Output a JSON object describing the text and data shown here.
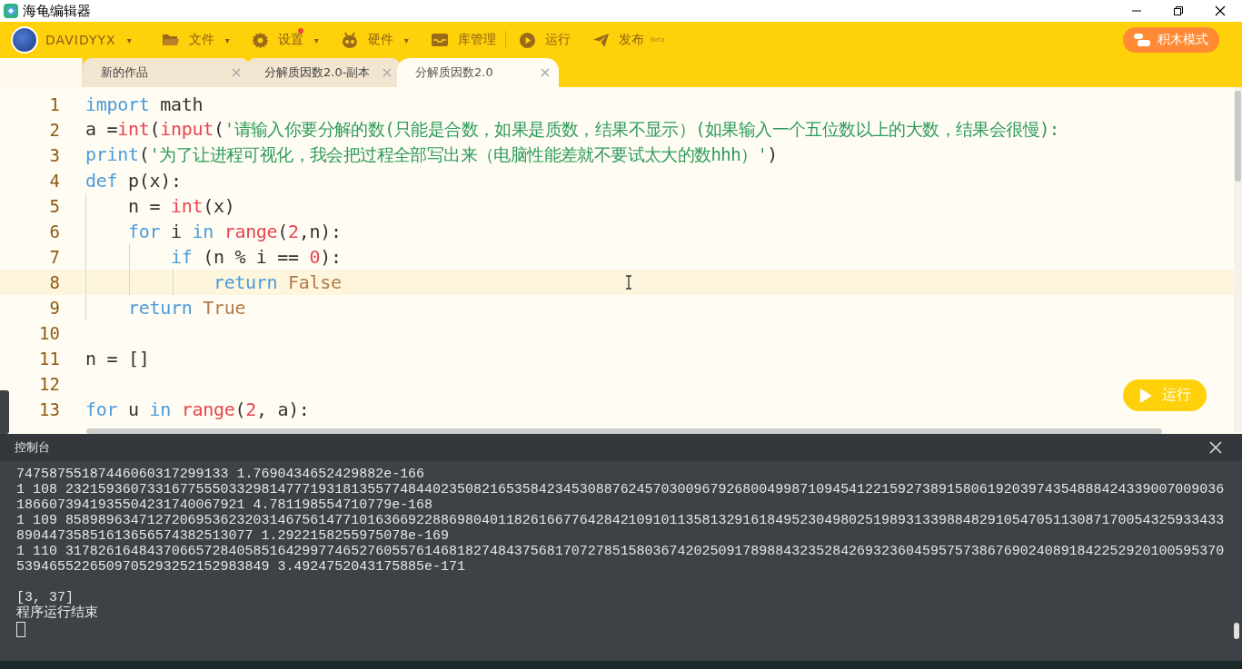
{
  "window": {
    "title": "海龟编辑器"
  },
  "toolbar": {
    "user": "DAVIDYYX",
    "user_caret": "▾",
    "menus": [
      {
        "label": "文件",
        "kind": "dropdown",
        "caret": "▾",
        "notify": false
      },
      {
        "label": "设置",
        "kind": "dropdown",
        "caret": "▾",
        "notify": true
      },
      {
        "label": "硬件",
        "kind": "dropdown",
        "caret": "▾",
        "notify": false
      },
      {
        "label": "库管理",
        "kind": "plain",
        "notify": false
      },
      {
        "label": "运行",
        "kind": "plain",
        "notify": false
      },
      {
        "label": "发布",
        "kind": "beta",
        "badge": "Beta",
        "notify": false
      }
    ],
    "mode_button": "积木模式"
  },
  "tabs": [
    {
      "label": "新的作品",
      "selected": false
    },
    {
      "label": "分解质因数2.0-副本",
      "selected": false
    },
    {
      "label": "分解质因数2.0",
      "selected": true
    }
  ],
  "editor": {
    "lines": [
      {
        "n": "1",
        "current": false,
        "tokens": [
          {
            "text": "import",
            "kind": "keyword"
          },
          {
            "text": " math",
            "kind": "plain"
          }
        ]
      },
      {
        "n": "2",
        "current": false,
        "tokens": [
          {
            "text": "a =",
            "kind": "plain"
          },
          {
            "text": "int",
            "kind": "builtin"
          },
          {
            "text": "(",
            "kind": "plain"
          },
          {
            "text": "input",
            "kind": "builtin"
          },
          {
            "text": "(",
            "kind": "plain"
          },
          {
            "text": "'请输入你要分解的数(只能是合数，如果是质数，结果不显示）(如果输入一个五位数以上的大数，结果会很慢):",
            "kind": "string"
          }
        ]
      },
      {
        "n": "3",
        "current": false,
        "tokens": [
          {
            "text": "print",
            "kind": "keyword"
          },
          {
            "text": "(",
            "kind": "plain"
          },
          {
            "text": "'为了让进程可视化，我会把过程全部写出来（电脑性能差就不要试太大的数hhh）'",
            "kind": "string"
          },
          {
            "text": ")",
            "kind": "plain"
          }
        ]
      },
      {
        "n": "4",
        "current": false,
        "tokens": [
          {
            "text": "def",
            "kind": "keyword"
          },
          {
            "text": " p(x):",
            "kind": "plain"
          }
        ]
      },
      {
        "n": "5",
        "current": false,
        "tokens": [
          {
            "text": "    n = ",
            "kind": "plain"
          },
          {
            "text": "int",
            "kind": "builtin"
          },
          {
            "text": "(x)",
            "kind": "plain"
          }
        ]
      },
      {
        "n": "6",
        "current": false,
        "tokens": [
          {
            "text": "    for",
            "kind": "keyword"
          },
          {
            "text": " i ",
            "kind": "plain"
          },
          {
            "text": "in",
            "kind": "keyword"
          },
          {
            "text": " range",
            "kind": "builtin"
          },
          {
            "text": "(",
            "kind": "plain"
          },
          {
            "text": "2",
            "kind": "number"
          },
          {
            "text": ",n):",
            "kind": "plain"
          }
        ]
      },
      {
        "n": "7",
        "current": false,
        "tokens": [
          {
            "text": "        if",
            "kind": "keyword"
          },
          {
            "text": " (n % i == ",
            "kind": "plain"
          },
          {
            "text": "0",
            "kind": "number"
          },
          {
            "text": "):",
            "kind": "plain"
          }
        ]
      },
      {
        "n": "8",
        "current": true,
        "tokens": [
          {
            "text": "            return",
            "kind": "keyword"
          },
          {
            "text": " False",
            "kind": "constant"
          }
        ]
      },
      {
        "n": "9",
        "current": false,
        "tokens": [
          {
            "text": "    return",
            "kind": "keyword"
          },
          {
            "text": " True",
            "kind": "constant"
          }
        ]
      },
      {
        "n": "10",
        "current": false
      },
      {
        "n": "11",
        "current": false,
        "tokens": [
          {
            "text": "n = []",
            "kind": "plain"
          }
        ]
      },
      {
        "n": "12",
        "current": false
      },
      {
        "n": "13",
        "current": false,
        "tokens": [
          {
            "text": "for",
            "kind": "keyword"
          },
          {
            "text": " u ",
            "kind": "plain"
          },
          {
            "text": "in",
            "kind": "keyword"
          },
          {
            "text": " range",
            "kind": "builtin"
          },
          {
            "text": "(",
            "kind": "plain"
          },
          {
            "text": "2",
            "kind": "number"
          },
          {
            "text": ", a):",
            "kind": "plain"
          }
        ]
      }
    ]
  },
  "run_button": "运行",
  "console": {
    "title": "控制台",
    "blocks": [
      [
        "74758755187446060317299133 1.7690434652429882e-166",
        "1 108 2321593607331677555033298147771931813557748440235082165358423453088762457030096792680049987109454122159273891580619203974354888424339007009036",
        "1866073941935504231740067921 4.781198554710779e-168",
        "1 109 8589896347127206953623203146756147710163669228869804011826166776428421091011358132916184952304980251989313398848291054705113087170054325933433",
        "89044735851613656574382513077 1.2922158255975078e-169",
        "1 110 3178261648437066572840585164299774652760557614681827484375681707278515803674202509178988432352842693236045957573867690240891842252920100595370",
        "5394655226509705293252152983849 3.4924752043175885e-171"
      ],
      [
        "[3, 37]",
        "程序运行结束"
      ]
    ]
  }
}
